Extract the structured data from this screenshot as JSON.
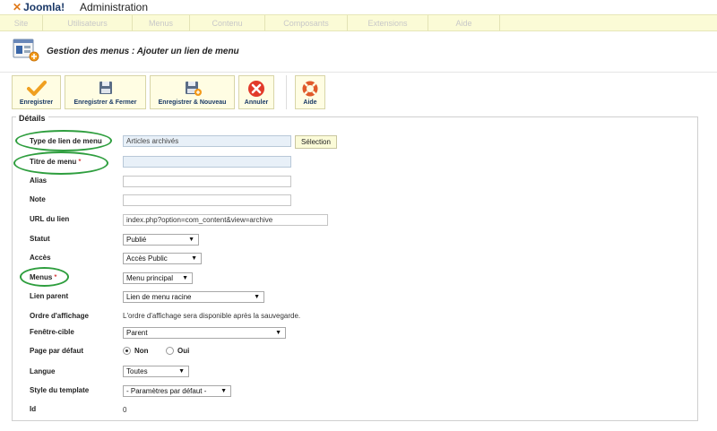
{
  "brand": {
    "logo_text": "Joomla!",
    "admin_label": "Administration"
  },
  "menubar": {
    "items": [
      "Site",
      "Utilisateurs",
      "Menus",
      "Contenu",
      "Composants",
      "Extensions",
      "Aide"
    ]
  },
  "header": {
    "title": "Gestion des menus : Ajouter un lien de menu",
    "icon": "menu-manager-add-icon"
  },
  "toolbar": {
    "save": "Enregistrer",
    "save_close": "Enregistrer & Fermer",
    "save_new": "Enregistrer & Nouveau",
    "cancel": "Annuler",
    "help": "Aide"
  },
  "form": {
    "legend": "Détails",
    "menu_type": {
      "label": "Type de lien de menu",
      "value": "Articles archivés",
      "button": "Sélection"
    },
    "title": {
      "label": "Titre de menu",
      "required": "*",
      "value": ""
    },
    "alias": {
      "label": "Alias",
      "value": ""
    },
    "note": {
      "label": "Note",
      "value": ""
    },
    "link": {
      "label": "URL du lien",
      "value": "index.php?option=com_content&view=archive"
    },
    "status": {
      "label": "Statut",
      "value": "Publié"
    },
    "access": {
      "label": "Accès",
      "value": "Accès Public"
    },
    "menus": {
      "label": "Menus",
      "required": "*",
      "value": "Menu principal"
    },
    "parent": {
      "label": "Lien parent",
      "value": "Lien de menu racine"
    },
    "ordering": {
      "label": "Ordre d'affichage",
      "value": "L'ordre d'affichage sera disponible après la sauvegarde."
    },
    "target": {
      "label": "Fenêtre-cible",
      "value": "Parent"
    },
    "home": {
      "label": "Page par défaut",
      "options": [
        "Non",
        "Oui"
      ],
      "selected": "Non"
    },
    "language": {
      "label": "Langue",
      "value": "Toutes"
    },
    "template_style": {
      "label": "Style du template",
      "value": "- Paramètres par défaut -"
    },
    "id": {
      "label": "Id",
      "value": "0"
    }
  },
  "colors": {
    "menubar_bg": "#fbfbd6",
    "highlight_ring": "#2e9e3e",
    "toolbar_label": "#1a3a66"
  }
}
